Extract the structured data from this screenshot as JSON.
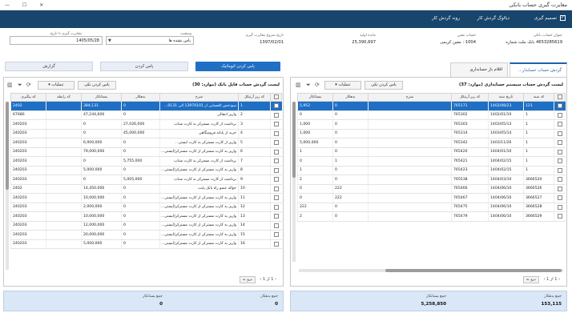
{
  "window": {
    "title": "مغایرت گیری حساب بانکی",
    "controls": "— ☐ ✕"
  },
  "toolbar": {
    "items": [
      "تصمیم گیری",
      "دیالوگ گردش کار",
      "روند گردش کار"
    ]
  },
  "header": {
    "bank_account_label": "عنوان حساب بانکی",
    "bank_account_value": "4653285619 بانک ملت شماره",
    "account_no_label": "حساب معین",
    "account_no_value": "1004 : معین کریمی",
    "opening_balance_label": "مانده اولیه",
    "opening_balance_value": "25,390,697",
    "start_date_label": "تاریخ شروع مغایرت گیری",
    "start_date_value": "1397/02/01",
    "status_label": "وضعیت",
    "status_value": "پاس نشده ها",
    "to_date_label": "مغایرت گیری تا تاریخ",
    "to_date_value": "1405/05/28"
  },
  "right_panel": {
    "tabs": [
      "گردش حساب حسابدار...",
      "اقلام باز حسابداری"
    ],
    "title": "لیست گردش حساب سیستم حسابداری (موارد: 37)",
    "operations_label": "عملیات",
    "pass_single_label": "پاس کردن تکی",
    "columns": [
      "",
      "کد سند",
      "تاریخ سند",
      "کد ریز آرتیکل",
      "شرح",
      "بدهکار",
      "بستانکار"
    ],
    "rows": [
      [
        "121",
        "1402/08/23",
        "765171",
        "",
        "0",
        "5,952"
      ],
      [
        "1",
        "1402/01/10",
        "765302",
        "",
        "0",
        "0"
      ],
      [
        "1",
        "1403/05/13",
        "765303",
        "",
        "0",
        "1,000"
      ],
      [
        "1",
        "1403/05/14",
        "765314",
        "",
        "0",
        "1,000"
      ],
      [
        "1",
        "1403/11/26",
        "765342",
        "",
        "0",
        "5,000,000"
      ],
      [
        "1",
        "1404/01/10",
        "765420",
        "",
        "0",
        "1"
      ],
      [
        "1",
        "1404/02/15",
        "765421",
        "",
        "1",
        "0"
      ],
      [
        "1",
        "1404/02/15",
        "765423",
        "",
        "0",
        "1"
      ],
      [
        "3666520",
        "1404/03/10",
        "765538",
        "",
        "0",
        "2"
      ],
      [
        "3666526",
        "1404/06/10",
        "765466",
        "",
        "222",
        "0"
      ],
      [
        "3666527",
        "1404/06/10",
        "765467",
        "",
        "222",
        "0"
      ],
      [
        "3666528",
        "1404/06/10",
        "765475",
        "",
        "0",
        "222"
      ],
      [
        "3666529",
        "1404/06/10",
        "765479",
        "",
        "0",
        "2"
      ]
    ],
    "pager": {
      "page": "1",
      "of": "1",
      "goto": "برو به"
    },
    "footer_label": "جمع بدهکار",
    "footer_value": "153,115",
    "footer2_label": "جمع بستانکار",
    "footer2_value": "5,258,850"
  },
  "left_panel": {
    "buttons": [
      "پاس کردن اتوماتیک",
      "پاس کردن",
      "گزارش"
    ],
    "title": "لیست گردش حساب فایل بانک (موارد: 30)",
    "operations_label": "عملیات",
    "pass_single_label": "پاس کردن تکی",
    "columns": [
      "",
      "کد ریز آرتیکل",
      "شرح",
      "بدهکار",
      "بستانکار",
      "کد رابطه",
      "کد پیگیری"
    ],
    "rows": [
      [
        "1",
        "سودخش الحسابی از 13970101 الی 0131...",
        "0",
        "384,131",
        "",
        "2402"
      ],
      [
        "2",
        "واریز انتقالی",
        "0",
        "47,244,600",
        "",
        "67686"
      ],
      [
        "3",
        "برداشت از کارت مسترکر به کارت شتاب",
        "27,026,000",
        "0",
        "",
        "240203"
      ],
      [
        "4",
        "خرید از پایانه فروشگاهی",
        "45,000,000",
        "0",
        "",
        "240203"
      ],
      [
        "5",
        "واریز از کارت مسترکر به کارت ایستر...",
        "0",
        "6,000,000",
        "",
        "240203"
      ],
      [
        "6",
        "واریز به کارت مسترکر از کارت مسترکر(ایستی...",
        "0",
        "79,000,000",
        "",
        "240203"
      ],
      [
        "7",
        "برداشت از کارت مسترکر به کارت شتاب",
        "5,755,000",
        "0",
        "",
        "240203"
      ],
      [
        "8",
        "واریز به کارت مسترکر از کارت مسترکر(ایستی...",
        "0",
        "5,000,000",
        "",
        "240203"
      ],
      [
        "9",
        "برداشت از کارت مسترکر به کارت شتاب",
        "5,005,000",
        "0",
        "",
        "240203"
      ],
      [
        "10",
        "حواله عضو راه بانک پایت",
        "0",
        "14,450,000",
        "",
        "2402"
      ],
      [
        "11",
        "واریز به کارت مسترکر از کارت مسترکر(ایستی...",
        "0",
        "10,000,000",
        "",
        "240203"
      ],
      [
        "12",
        "واریز به کارت مسترکر از کارت مسترکر(ایستی...",
        "0",
        "2,000,000",
        "",
        "240203"
      ],
      [
        "13",
        "واریز به کارت مسترکر از کارت مسترکر(ایستی...",
        "0",
        "10,000,000",
        "",
        "240203"
      ],
      [
        "14",
        "واریز به کارت مسترکر از کارت مسترکر(ایستی...",
        "0",
        "12,000,000",
        "",
        "240203"
      ],
      [
        "15",
        "واریز به کارت مسترکر از کارت مسترکر(ایستی...",
        "0",
        "20,000,000",
        "",
        "240203"
      ],
      [
        "16",
        "واریز به کارت مسترکر از کارت مسترکر(ایستی...",
        "0",
        "5,000,000",
        "",
        "240203"
      ]
    ],
    "pager": {
      "page": "1",
      "of": "1",
      "goto": "برو به"
    },
    "footer_label": "جمع بدهکار",
    "footer_value": "0",
    "footer2_label": "جمع بستانکار",
    "footer2_value": "0"
  }
}
